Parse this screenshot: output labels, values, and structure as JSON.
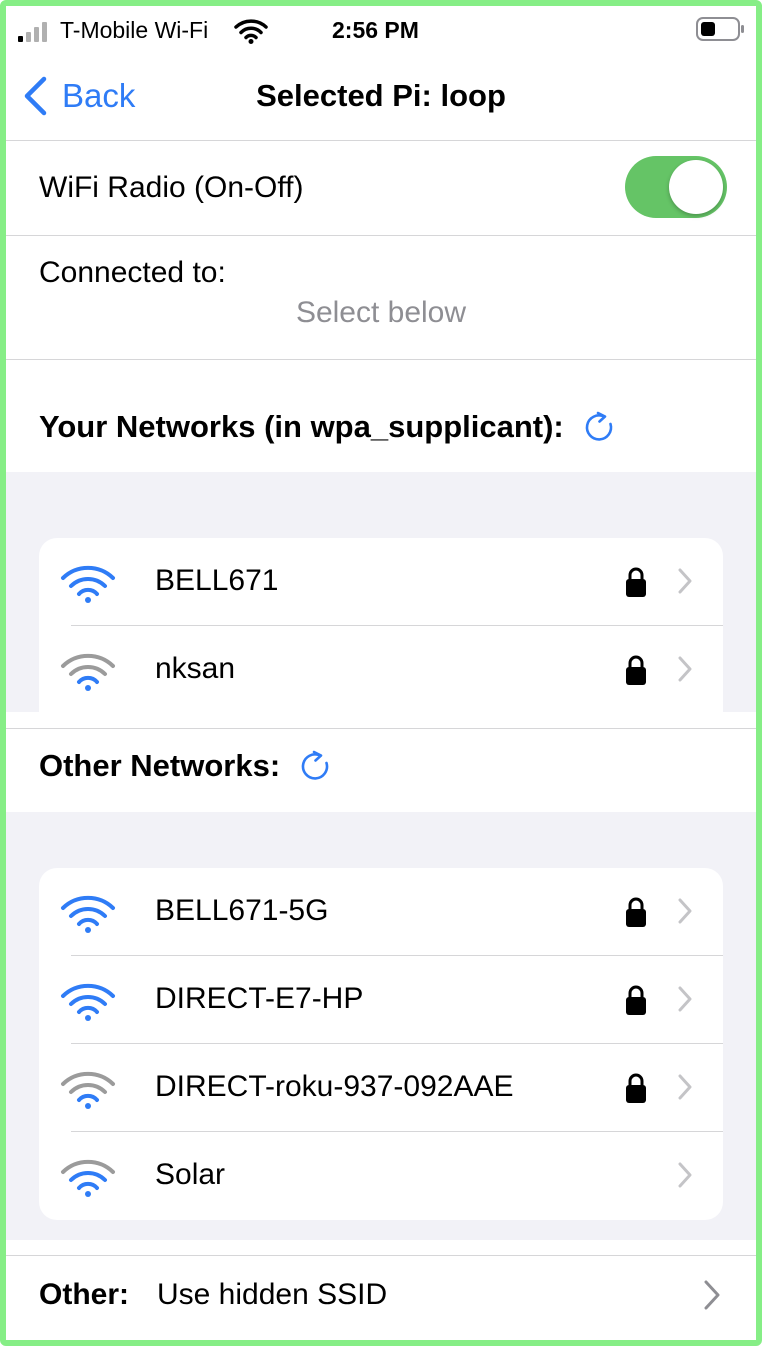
{
  "status_bar": {
    "carrier": "T-Mobile Wi-Fi",
    "time": "2:56 PM",
    "signal_icon": "cell-signal-icon",
    "wifi_icon": "wifi-icon",
    "battery_icon": "battery-icon"
  },
  "nav": {
    "back_label": "Back",
    "title": "Selected Pi: loop"
  },
  "wifi_radio": {
    "label": "WiFi Radio (On-Off)",
    "on": true
  },
  "connection": {
    "label": "Connected to:",
    "value": "Select below"
  },
  "your_networks": {
    "title": "Your Networks (in wpa_supplicant):",
    "items": [
      {
        "name": "BELL671",
        "signal": "strong",
        "locked": true
      },
      {
        "name": "nksan",
        "signal": "weak",
        "locked": true
      }
    ]
  },
  "other_networks": {
    "title": "Other Networks:",
    "items": [
      {
        "name": "BELL671-5G",
        "signal": "strong",
        "locked": true
      },
      {
        "name": "DIRECT-E7-HP",
        "signal": "strong",
        "locked": true
      },
      {
        "name": "DIRECT-roku-937-092AAE",
        "signal": "weak",
        "locked": true
      },
      {
        "name": "Solar",
        "signal": "weak",
        "locked": false
      }
    ]
  },
  "other_row": {
    "key": "Other:",
    "value": "Use hidden SSID"
  },
  "colors": {
    "accent": "#2f7cf6",
    "toggle_on": "#65c466",
    "secondary_text": "#8e8e93",
    "group_background": "#f2f2f7",
    "frame_border": "#86ee86"
  }
}
